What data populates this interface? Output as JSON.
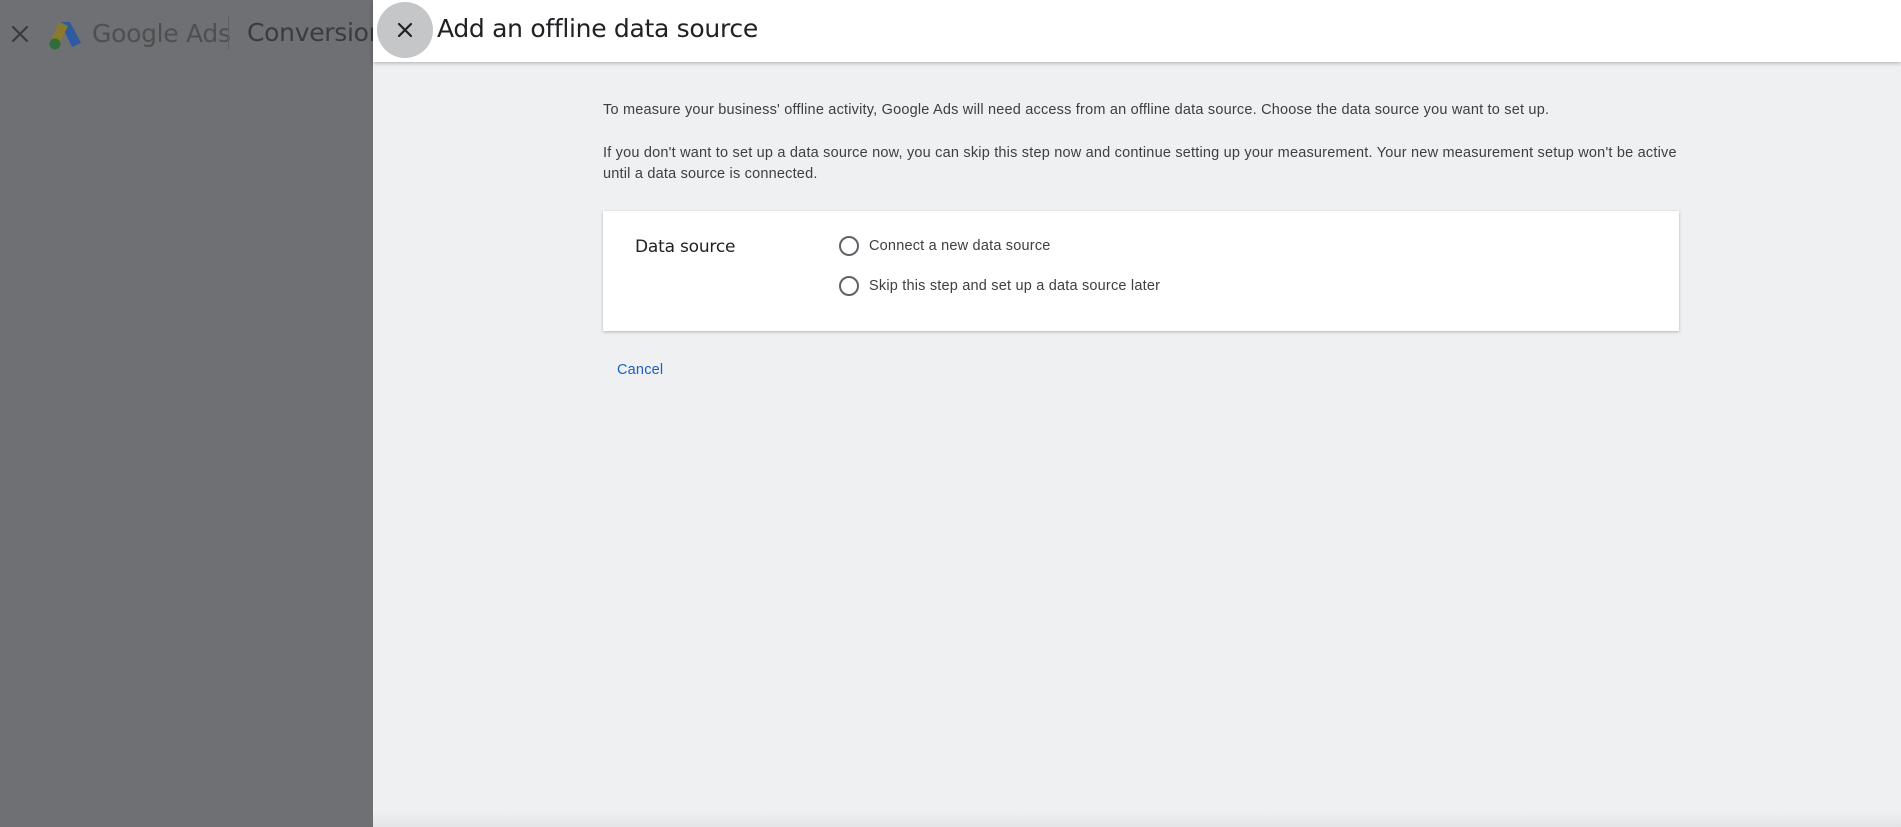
{
  "background": {
    "brand": "Google Ads",
    "page_title": "Conversions"
  },
  "sheet": {
    "title": "Add an offline data source",
    "description_1": "To measure your business' offline activity, Google Ads will need access from an offline data source. Choose the data source you want to set up.",
    "description_2": "If you don't want to set up a data source now, you can skip this step now and continue setting up your measurement. Your new measurement setup won't be active until a data source is connected.",
    "card": {
      "label": "Data source",
      "options": [
        {
          "label": "Connect a new data source",
          "selected": false
        },
        {
          "label": "Skip this step and set up a data source later",
          "selected": false
        }
      ]
    },
    "cancel_label": "Cancel"
  },
  "icons": {
    "background_close": "close-icon",
    "sheet_close": "close-icon",
    "logo": "google-ads-logo"
  },
  "colors": {
    "link": "#1a5fc8",
    "overlay": "#6f7073",
    "sheet_bg": "#eff0f2"
  }
}
